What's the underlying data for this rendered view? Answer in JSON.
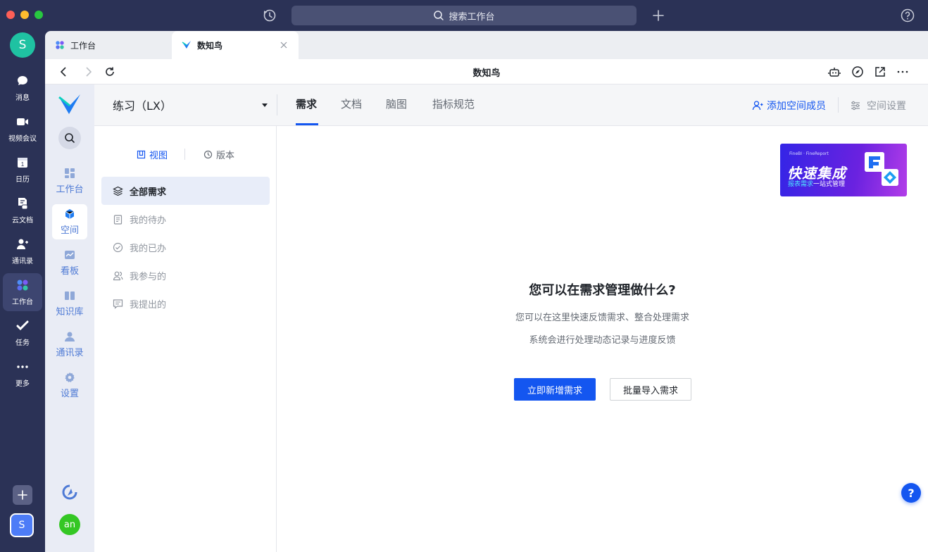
{
  "titlebar": {
    "search_placeholder": "搜索工作台"
  },
  "rail": {
    "avatar_letter": "S",
    "items": [
      {
        "label": "消息",
        "icon": "chat-icon"
      },
      {
        "label": "视频会议",
        "icon": "video-icon"
      },
      {
        "label": "日历",
        "icon": "calendar-icon"
      },
      {
        "label": "云文档",
        "icon": "cloud-doc-icon"
      },
      {
        "label": "通讯录",
        "icon": "contacts-icon"
      },
      {
        "label": "工作台",
        "icon": "workspace-icon",
        "active": true
      },
      {
        "label": "任务",
        "icon": "task-icon"
      },
      {
        "label": "更多",
        "icon": "more-icon"
      }
    ],
    "bottom_workspace_letter": "S"
  },
  "browser_tabs": [
    {
      "label": "工作台",
      "icon": "workspace-icon"
    },
    {
      "label": "数知鸟",
      "icon": "shuzhiniao-logo-icon",
      "active": true
    }
  ],
  "address": {
    "title": "数知鸟"
  },
  "side2": {
    "items": [
      {
        "label": "工作台",
        "icon": "dashboard-icon"
      },
      {
        "label": "空间",
        "icon": "cube-icon",
        "active": true
      },
      {
        "label": "看板",
        "icon": "board-icon"
      },
      {
        "label": "知识库",
        "icon": "book-icon"
      },
      {
        "label": "通讯录",
        "icon": "person-icon"
      },
      {
        "label": "设置",
        "icon": "gear-icon"
      }
    ],
    "user_avatar": "an"
  },
  "header": {
    "space_name": "练习（LX）",
    "tabs": [
      {
        "label": "需求",
        "active": true
      },
      {
        "label": "文档"
      },
      {
        "label": "脑图"
      },
      {
        "label": "指标规范"
      }
    ],
    "add_member": "添加空间成员",
    "space_settings": "空间设置"
  },
  "leftpanel": {
    "segments": {
      "view": "视图",
      "version": "版本"
    },
    "items": [
      {
        "label": "全部需求",
        "icon": "layers-icon",
        "active": true
      },
      {
        "label": "我的待办",
        "icon": "clipboard-icon"
      },
      {
        "label": "我的已办",
        "icon": "check-circle-icon"
      },
      {
        "label": "我参与的",
        "icon": "people-icon"
      },
      {
        "label": "我提出的",
        "icon": "comment-icon"
      }
    ]
  },
  "banner": {
    "small": "FineBI · FineReport",
    "title": "快速集成",
    "sub_highlight": "报表需求",
    "sub_rest": "一站式管理"
  },
  "empty": {
    "title": "您可以在需求管理做什么?",
    "line1": "您可以在这里快速反馈需求、整合处理需求",
    "line2": "系统会进行处理动态记录与进度反馈",
    "primary_button": "立即新增需求",
    "secondary_button": "批量导入需求"
  },
  "help": "?"
}
